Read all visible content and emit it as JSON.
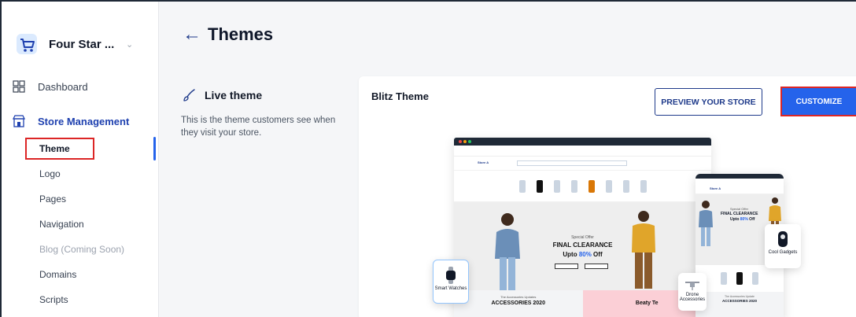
{
  "sidebar": {
    "store_name": "Four Star ...",
    "nav": {
      "dashboard": "Dashboard",
      "store_management": "Store Management"
    },
    "sub_items": {
      "theme": "Theme",
      "logo": "Logo",
      "pages": "Pages",
      "navigation": "Navigation",
      "blog": "Blog (Coming Soon)",
      "domains": "Domains",
      "scripts": "Scripts"
    }
  },
  "header": {
    "title": "Themes"
  },
  "live_theme": {
    "heading": "Live theme",
    "description": "This is the theme customers see when they visit your store."
  },
  "card": {
    "theme_name": "Blitz Theme",
    "preview_button": "PREVIEW YOUR STORE",
    "customize_button": "CUSTOMIZE"
  },
  "mockup": {
    "store_name": "Store A",
    "offer_small": "Special Offer",
    "offer_big": "FINAL CLEARANCE",
    "offer_prefix": "Upto ",
    "offer_pct": "80%",
    "offer_suffix": " Off",
    "footer_a_label": "The Accessories Updates",
    "footer_a_title": "ACCESSORIES 2020",
    "footer_b_title": "Beaty Te",
    "phone_store": "Store A",
    "phone_offer_small": "Special Offer",
    "phone_offer_big": "FINAL CLEARANCE",
    "phone_offer_prefix": "Upto ",
    "phone_offer_pct": "80%",
    "phone_offer_suffix": " Off",
    "phone_foot_label": "The Accessories Update",
    "phone_foot_title": "ACCESSORIES 2020",
    "float_watch": "Smart Watches",
    "float_gadgets": "Cool Gadgets",
    "float_drone": "Drone Accessories"
  },
  "colors": {
    "primary": "#2563eb",
    "navy": "#1e3a8a",
    "highlight": "#dc2626"
  }
}
